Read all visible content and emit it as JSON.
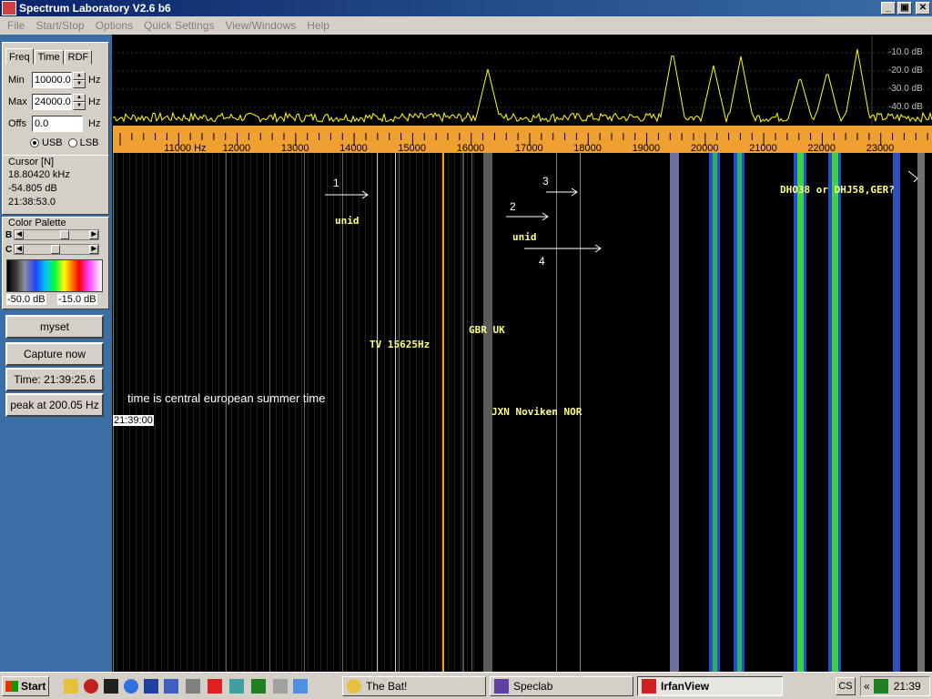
{
  "window": {
    "title": "Spectrum Laboratory V2.6 b6",
    "min": "_",
    "max": "▣",
    "close": "✕"
  },
  "menu": [
    "File",
    "Start/Stop",
    "Options",
    "Quick Settings",
    "View/Windows",
    "Help"
  ],
  "left": {
    "tabs": [
      "Freq",
      "Time",
      "RDF"
    ],
    "min_label": "Min",
    "min_value": "10000.0",
    "min_unit": "Hz",
    "max_label": "Max",
    "max_value": "24000.0",
    "max_unit": "Hz",
    "offs_label": "Offs",
    "offs_value": "0.0",
    "offs_unit": "Hz",
    "usb": "USB",
    "lsb": "LSB",
    "cursor_title": "Cursor [N]",
    "cursor_freq": "18.80420 kHz",
    "cursor_db": "-54.805 dB",
    "cursor_time": "21:38:53.0",
    "palette_title": "Color Palette",
    "b_label": "B",
    "c_label": "C",
    "palette_min": "-50.0 dB",
    "palette_max": "-15.0 dB",
    "btn_myset": "myset",
    "btn_capture": "Capture now",
    "btn_time": "Time:  21:39:25.6",
    "btn_peak": "peak at 200.05 Hz"
  },
  "spectrum": {
    "db_labels": [
      "-10.0 dB",
      "-20.0 dB",
      "-30.0 dB",
      "-40.0 dB"
    ],
    "freq_labels": [
      "11000 Hz",
      "12000",
      "13000",
      "14000",
      "15000",
      "16000",
      "17000",
      "18000",
      "19000",
      "20000",
      "21000",
      "22000",
      "23000"
    ],
    "min_hz": 10000,
    "max_hz": 24000
  },
  "waterfall": {
    "time_tag": "21:39:00",
    "note": "time is central european summer time",
    "labels": {
      "unid1": "unid",
      "unid2": "unid",
      "tv": "TV 15625Hz",
      "gbr": "GBR UK",
      "jxn": "JXN Noviken NOR",
      "dhj": "DHO38 or DHJ58,GER?",
      "n1": "1",
      "n2": "2",
      "n3": "3",
      "n4": "4"
    }
  },
  "taskbar": {
    "start": "Start",
    "tasks": [
      "The Bat!",
      "Speclab",
      "IrfanView"
    ],
    "cs": "CS",
    "clock": "21:39",
    "chev": "«"
  },
  "colors": {
    "titlebar": "#0a246a",
    "scale": "#f0a030",
    "trace": "#ffff00"
  }
}
